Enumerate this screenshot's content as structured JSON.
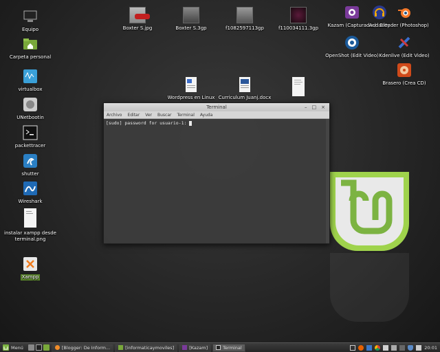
{
  "desktop_left": [
    {
      "label": "Equipo"
    },
    {
      "label": "Carpeta personal"
    },
    {
      "label": "virtualbox"
    },
    {
      "label": "UNetbootin"
    },
    {
      "label": "packettracer"
    },
    {
      "label": "shutter"
    },
    {
      "label": "Wireshark"
    },
    {
      "label": "instalar xampp desde terminal.png"
    },
    {
      "label": "Xampp"
    }
  ],
  "desktop_top": [
    {
      "label": "Boxter S.jpg"
    },
    {
      "label": "Boxter S.3gp"
    },
    {
      "label": "f1082597113gp"
    },
    {
      "label": "f110034111.3gp"
    }
  ],
  "desktop_right": [
    {
      "label": "Kazam (Capturador)"
    },
    {
      "label": "Audacity"
    },
    {
      "label": "Blender (Photoshop)"
    },
    {
      "label": "OpenShot (Edit Video)"
    },
    {
      "label": "Kdenlive (Edit Video)"
    },
    {
      "label": "Brasero (Crea CD)"
    }
  ],
  "desktop_docs": [
    {
      "label": "Wordpress en Linux"
    },
    {
      "label": "Curriculum Juanj.docx"
    },
    {
      "label": ""
    }
  ],
  "terminal": {
    "title": "Terminal",
    "menu": [
      "Archivo",
      "Editar",
      "Ver",
      "Buscar",
      "Terminal",
      "Ayuda"
    ],
    "prompt": "[sudo] password for usuario-1: "
  },
  "taskbar": {
    "menu_label": "Menú",
    "tasks": [
      {
        "label": "[Blogger: De Inform..."
      },
      {
        "label": "[informaticaymoviles]"
      },
      {
        "label": "[Kazam]"
      },
      {
        "label": "Terminal"
      }
    ],
    "clock": "20:01"
  }
}
